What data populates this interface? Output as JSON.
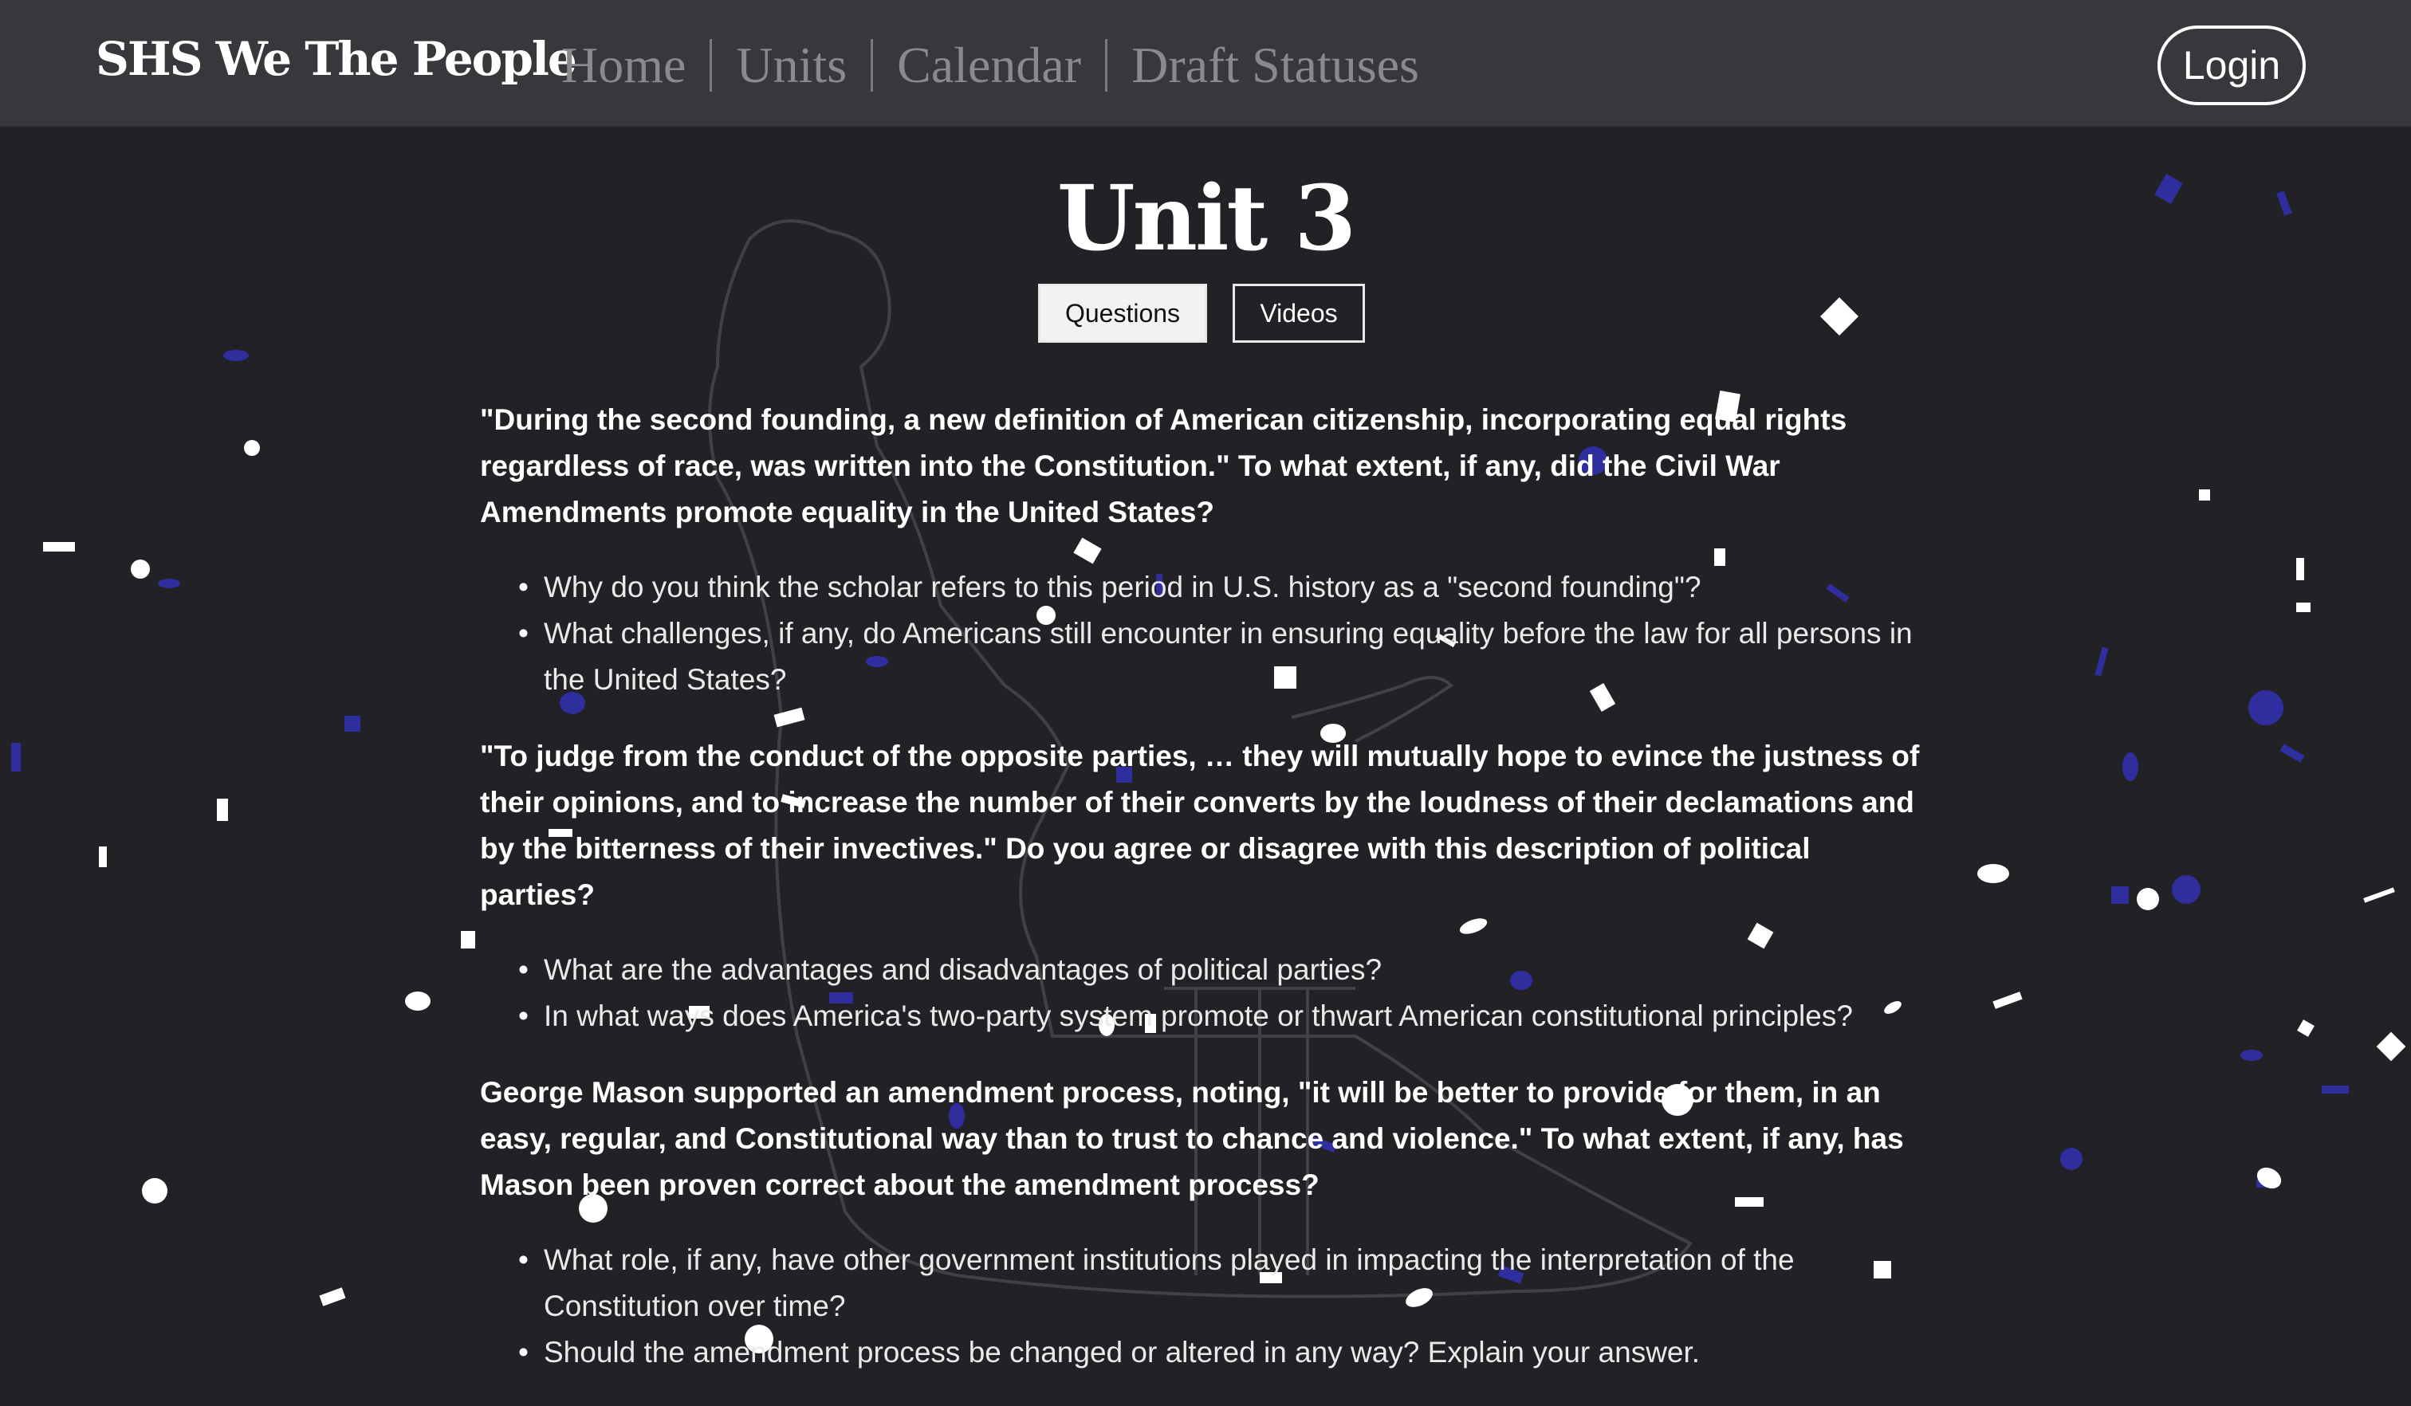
{
  "navbar": {
    "brand": "SHS We The People",
    "links": [
      "Home",
      "Units",
      "Calendar",
      "Draft Statuses"
    ],
    "login": "Login"
  },
  "page": {
    "title": "Unit 3",
    "tabs": [
      "Questions",
      "Videos"
    ],
    "active_tab": "Questions"
  },
  "questions": [
    {
      "prompt": "\"During the second founding, a new definition of American citizenship, incorporating equal rights regardless of race, was written into the Constitution.\" To what extent, if any, did the Civil War Amendments promote equality in the United States?",
      "subs": [
        "Why do you think the scholar refers to this period in U.S. history as a \"second founding\"?",
        "What challenges, if any, do Americans still encounter in ensuring equality before the law for all persons in the United States?"
      ]
    },
    {
      "prompt": "\"To judge from the conduct of the opposite parties, … they will mutually hope to evince the justness of their opinions, and to increase the number of their converts by the loudness of their declamations and by the bitterness of their invectives.\" Do you agree or disagree with this description of political parties?",
      "subs": [
        "What are the advantages and disadvantages of political parties?",
        "In what ways does America's two-party system promote or thwart American constitutional principles?"
      ]
    },
    {
      "prompt": "George Mason supported an amendment process, noting, \"it will be better to provide for them, in an easy, regular, and Constitutional way than to trust to chance and violence.\" To what extent, if any, has Mason been proven correct about the amendment process?",
      "subs": [
        "What role, if any, have other government institutions played in impacting the interpretation of the Constitution over time?",
        "Should the amendment process be changed or altered in any way? Explain your answer."
      ]
    }
  ],
  "colors": {
    "background": "#222226",
    "navbar": "#38383c",
    "nav_link": "#8a8a8c",
    "confetti_blue": "#2e2e9e",
    "confetti_white": "#ffffff"
  }
}
